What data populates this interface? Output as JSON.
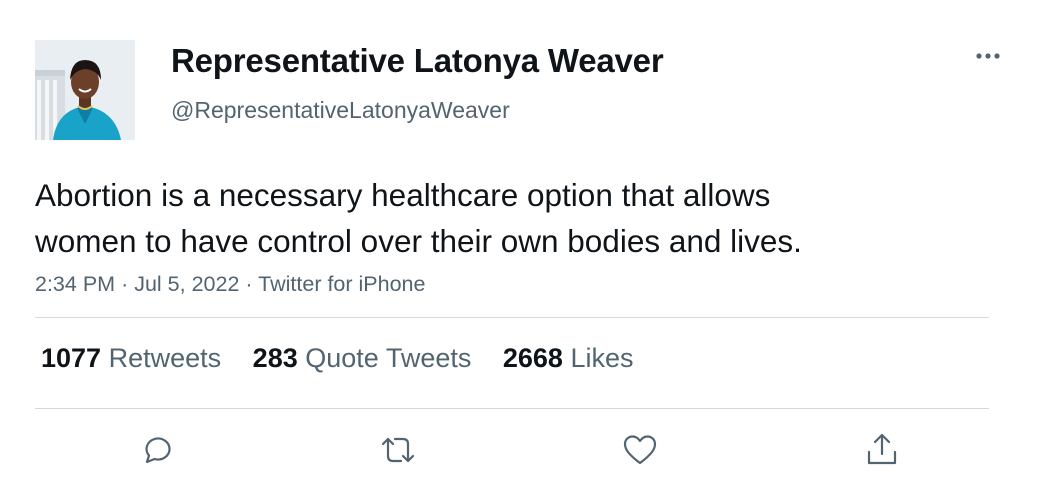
{
  "author": {
    "display_name": "Representative Latonya Weaver",
    "handle": "@RepresentativeLatonyaWeaver"
  },
  "tweet": {
    "text": "Abortion is a necessary healthcare option that allows\nwomen to have control over their own bodies and lives.",
    "time": "2:34 PM",
    "date": "Jul 5, 2022",
    "source": "Twitter for iPhone",
    "separator": "·"
  },
  "stats": {
    "retweets": {
      "count": "1077",
      "label": "Retweets"
    },
    "quote_tweets": {
      "count": "283",
      "label": "Quote Tweets"
    },
    "likes": {
      "count": "2668",
      "label": "Likes"
    }
  },
  "icons": {
    "more": "more-options-icon",
    "reply": "reply-icon",
    "retweet": "retweet-icon",
    "like": "like-icon",
    "share": "share-icon"
  },
  "colors": {
    "text": "#0f1419",
    "secondary": "#536471",
    "divider": "#cfd9de"
  }
}
